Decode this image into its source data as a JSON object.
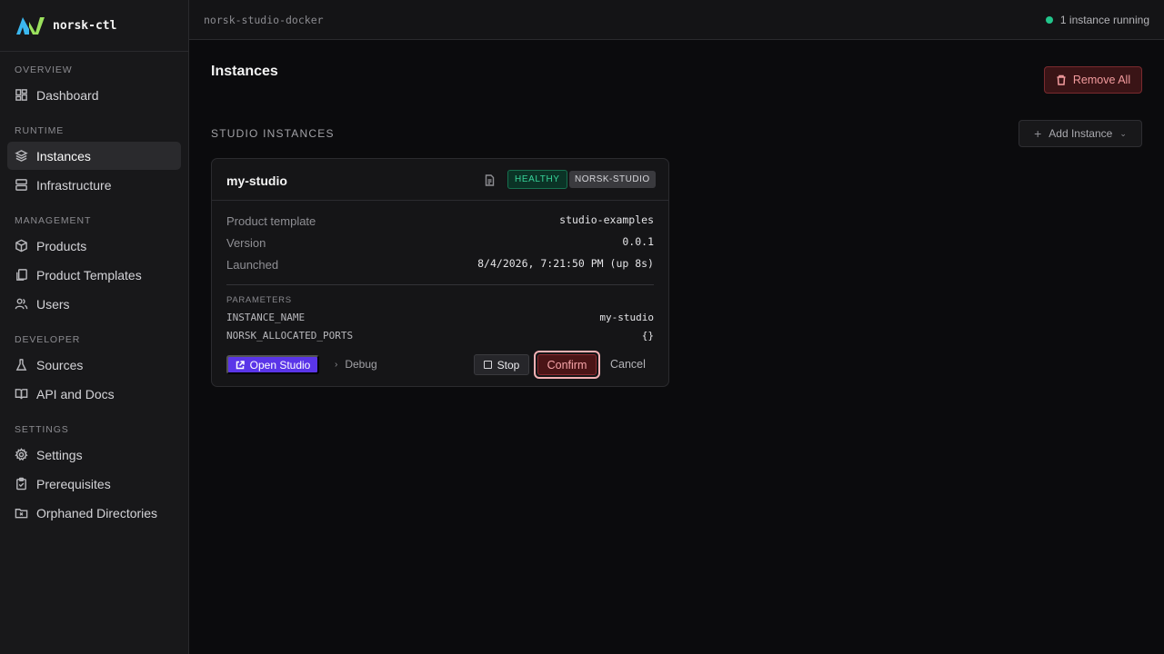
{
  "app": {
    "name": "norsk-ctl"
  },
  "topbar": {
    "environment": "norsk-studio-docker",
    "status": "1 instance running",
    "status_color": "#22c58b"
  },
  "sidebar": {
    "sections": [
      {
        "label": "OVERVIEW",
        "items": [
          {
            "label": "Dashboard",
            "icon": "dashboard-icon"
          }
        ]
      },
      {
        "label": "RUNTIME",
        "items": [
          {
            "label": "Instances",
            "icon": "layers-icon",
            "active": true
          },
          {
            "label": "Infrastructure",
            "icon": "server-icon"
          }
        ]
      },
      {
        "label": "MANAGEMENT",
        "items": [
          {
            "label": "Products",
            "icon": "package-icon"
          },
          {
            "label": "Product Templates",
            "icon": "copy-icon"
          },
          {
            "label": "Users",
            "icon": "users-icon"
          }
        ]
      },
      {
        "label": "DEVELOPER",
        "items": [
          {
            "label": "Sources",
            "icon": "flask-icon"
          },
          {
            "label": "API and Docs",
            "icon": "book-icon"
          }
        ]
      },
      {
        "label": "SETTINGS",
        "items": [
          {
            "label": "Settings",
            "icon": "gear-icon"
          },
          {
            "label": "Prerequisites",
            "icon": "clipboard-check-icon"
          },
          {
            "label": "Orphaned Directories",
            "icon": "folder-x-icon"
          }
        ]
      }
    ]
  },
  "main": {
    "title": "Instances",
    "remove_all_label": "Remove All",
    "section_title": "STUDIO INSTANCES",
    "add_instance_label": "Add Instance"
  },
  "instance": {
    "name": "my-studio",
    "health_badge": "HEALTHY",
    "type_badge": "NORSK-STUDIO",
    "fields": [
      {
        "label": "Product template",
        "value": "studio-examples"
      },
      {
        "label": "Version",
        "value": "0.0.1"
      },
      {
        "label": "Launched",
        "value": "8/4/2026, 7:21:50 PM (up 8s)"
      }
    ],
    "parameters_label": "PARAMETERS",
    "parameters": [
      {
        "key": "INSTANCE_NAME",
        "value": "my-studio"
      },
      {
        "key": "NORSK_ALLOCATED_PORTS",
        "value": "{}"
      }
    ],
    "actions": {
      "open": "Open Studio",
      "debug": "Debug",
      "stop": "Stop",
      "confirm": "Confirm",
      "cancel": "Cancel"
    }
  }
}
